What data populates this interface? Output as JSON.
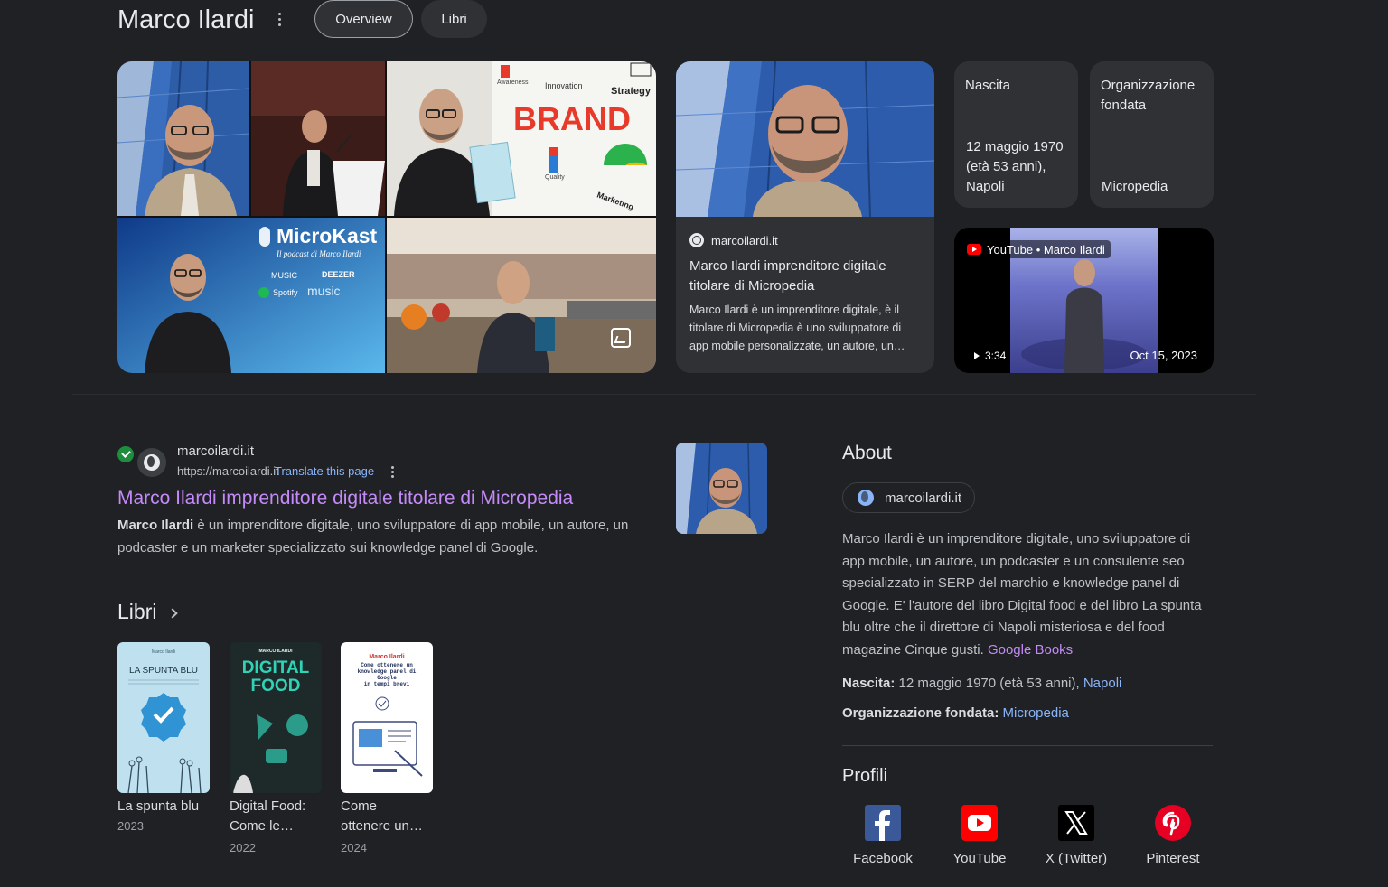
{
  "header": {
    "title": "Marco Ilardi",
    "tabs": [
      {
        "label": "Overview",
        "selected": true
      },
      {
        "label": "Libri",
        "selected": false
      }
    ]
  },
  "collage": {
    "tiles": [
      {
        "name": "portrait-glass-building"
      },
      {
        "name": "speaker-at-podium"
      },
      {
        "name": "holding-book-brand-board",
        "board_words": [
          "BRAND",
          "Innovation",
          "Strategy",
          "Marketing",
          "Awareness",
          "Quality"
        ]
      },
      {
        "name": "microkast-podcast",
        "title": "MicroKast",
        "subtitle": "Il podcast di Marco Ilardi",
        "platforms": [
          "MUSIC",
          "DEEZER",
          "Spotify",
          "music"
        ]
      },
      {
        "name": "kitchen-holding-book"
      }
    ]
  },
  "article_card": {
    "source": "marcoilardi.it",
    "title": "Marco Ilardi imprenditore digitale titolare di Micropedia",
    "snippet": "Marco Ilardi è un imprenditore digitale, è il titolare di Micropedia è uno sviluppatore di app mobile personalizzate, un autore, un…"
  },
  "facts": [
    {
      "label": "Nascita",
      "value": "12 maggio 1970 (età 53 anni), Napoli"
    },
    {
      "label": "Organizzazione fondata",
      "value": "Micropedia"
    }
  ],
  "video": {
    "source": "YouTube • Marco Ilardi",
    "duration": "3:34",
    "date": "Oct 15, 2023"
  },
  "result": {
    "site_name": "marcoilardi.it",
    "url": "https://marcoilardi.it",
    "translate_label": "Translate this page",
    "title": "Marco Ilardi imprenditore digitale titolare di Micropedia",
    "snippet_bold": "Marco Ilardi",
    "snippet_rest": " è un imprenditore digitale, uno sviluppatore di app mobile, un autore, un podcaster e un marketer specializzato sui knowledge panel di Google."
  },
  "libri": {
    "heading": "Libri",
    "books": [
      {
        "title_l1": "La spunta blu",
        "title_l2": "",
        "year": "2023",
        "cover_title": "LA SPUNTA BLU",
        "cover_author": "Marco Ilardi"
      },
      {
        "title_l1": "Digital Food:",
        "title_l2": "Come le…",
        "year": "2022",
        "cover_title_1": "DIGITAL",
        "cover_title_2": "FOOD",
        "cover_author": "MARCO ILARDI"
      },
      {
        "title_l1": "Come",
        "title_l2": "ottenere un…",
        "year": "2024",
        "cover_author": "Marco Ilardi",
        "cover_lines": [
          "Come ottenere un",
          "knowledge panel di",
          "Google",
          "in tempi brevi"
        ]
      }
    ]
  },
  "about": {
    "heading": "About",
    "site_chip": "marcoilardi.it",
    "description": "Marco Ilardi è un imprenditore digitale, uno sviluppatore di app mobile, un autore, un podcaster e un consulente seo specializzato in SERP del marchio e knowledge panel di Google. E' l'autore del libro Digital food e del libro La spunta blu oltre che il direttore di Napoli misteriosa e del food magazine Cinque gusti.",
    "source_link": "Google Books",
    "birth_label": "Nascita:",
    "birth_value": "12 maggio 1970 (età 53 anni), ",
    "birth_place": "Napoli",
    "org_label": "Organizzazione fondata:",
    "org_value": "Micropedia"
  },
  "profiles": {
    "heading": "Profili",
    "items": [
      {
        "label": "Facebook",
        "icon": "facebook-icon",
        "color": "#3b5998"
      },
      {
        "label": "YouTube",
        "icon": "youtube-icon",
        "color": "#ff0000"
      },
      {
        "label": "X (Twitter)",
        "icon": "x-twitter-icon",
        "color": "#000000"
      },
      {
        "label": "Pinterest",
        "icon": "pinterest-icon",
        "color": "#e60023"
      }
    ]
  },
  "colors": {
    "background": "#202124",
    "surface": "#303134",
    "link_blue": "#8ab4f8",
    "visited_purple": "#c58af9"
  }
}
